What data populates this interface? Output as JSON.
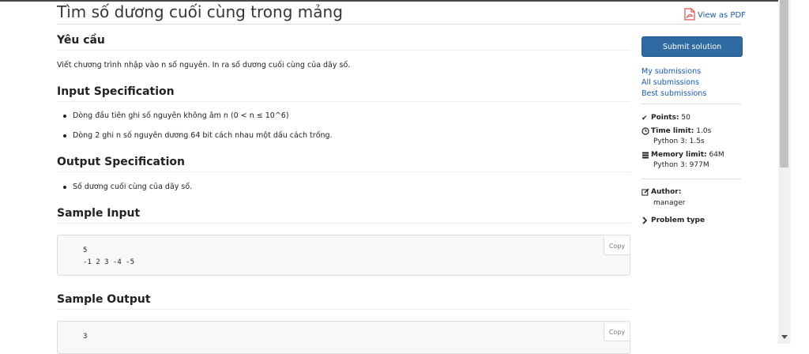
{
  "problem": {
    "title": "Tìm số dương cuối cùng trong mảng",
    "pdf_link": "View as PDF"
  },
  "sections": {
    "requirement": {
      "heading": "Yêu cầu",
      "text": "Viết chương trình nhập vào n số nguyên. In ra số dương cuối cùng của dãy số."
    },
    "input": {
      "heading": "Input Specification",
      "items": [
        "Dòng đầu tiên ghi số nguyên không âm n (0 < n ≤ 10^6)",
        "Dòng 2 ghi n số nguyên dương 64 bit cách nhau một dấu cách trống."
      ]
    },
    "output": {
      "heading": "Output Specification",
      "items": [
        "Số dương cuối cùng của dãy số."
      ]
    },
    "sample_input": {
      "heading": "Sample Input",
      "lines": [
        "5",
        "-1 2 3 -4 -5"
      ],
      "copy_label": "Copy"
    },
    "sample_output": {
      "heading": "Sample Output",
      "lines": [
        "3"
      ],
      "copy_label": "Copy"
    }
  },
  "sidebar": {
    "submit_label": "Submit solution",
    "links": [
      "My submissions",
      "All submissions",
      "Best submissions"
    ],
    "points_label": "Points:",
    "points_value": "50",
    "time_label": "Time limit:",
    "time_value": "1.0s",
    "time_python": "Python 3: 1.5s",
    "memory_label": "Memory limit:",
    "memory_value": "64M",
    "memory_python": "Python 3: 977M",
    "author_label": "Author:",
    "author_value": "manager",
    "problem_type_label": "Problem type"
  },
  "icons": {
    "pdf": "pdf-icon",
    "check": "check-icon",
    "clock": "clock-icon",
    "memory": "memory-icon",
    "author": "edit-icon",
    "chevron": "chevron-right-icon"
  }
}
